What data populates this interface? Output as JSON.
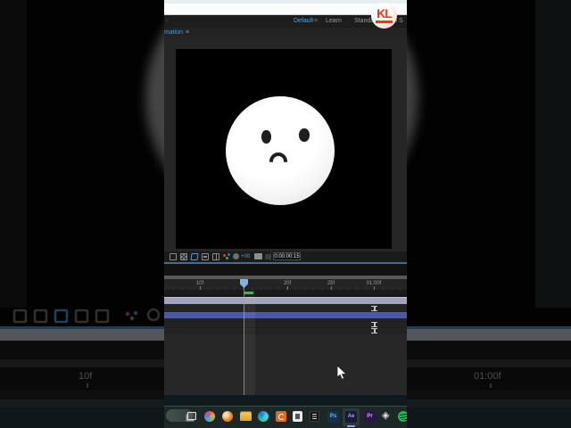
{
  "background": {
    "left_time_label": "10f",
    "right_time_label": "01:00f"
  },
  "watermark": {
    "text": "KL",
    "color": "#e8391d"
  },
  "menu_bar": {
    "left_glyph": "‹",
    "menu_icon": "≡",
    "workspaces": [
      {
        "label": "Default",
        "active": true
      },
      {
        "label": "Learn",
        "active": false
      },
      {
        "label": "Standard",
        "active": false
      },
      {
        "label": "ll S",
        "active": false
      }
    ]
  },
  "panel_tab": {
    "label": "mation",
    "menu_icon": "≡"
  },
  "viewer_toolbar": {
    "icons": [
      "preview-toggle-icon",
      "transparency-grid-icon",
      "mask-visibility-icon",
      "region-of-interest-icon",
      "view-options-icon",
      "channels-icon",
      "resolution-icon",
      "snapshot-camera-icon",
      "show-snapshot-icon"
    ],
    "exposure_label": "+00",
    "timecode": "0:00:00:15"
  },
  "timeline": {
    "ruler_labels": [
      {
        "text": "10f"
      },
      {
        "text": "20f"
      },
      {
        "text": "25f"
      },
      {
        "text": "01:00f"
      }
    ],
    "playhead_frame": "15f",
    "layers": [
      {
        "name": "lavender-layer",
        "color": "#a2a2bd"
      },
      {
        "name": "dark-layer-1",
        "out_handle": true
      },
      {
        "name": "selected-layer",
        "color": "#4c5aa6"
      },
      {
        "name": "dark-layer-2",
        "out_handle": true
      },
      {
        "name": "dark-layer-3",
        "out_handle": true
      }
    ]
  },
  "taskbar": {
    "apps": [
      {
        "name": "search-pill",
        "label": ""
      },
      {
        "name": "task-view",
        "label": ""
      },
      {
        "name": "photos",
        "label": ""
      },
      {
        "name": "blender",
        "label": ""
      },
      {
        "name": "file-explorer",
        "label": ""
      },
      {
        "name": "edge",
        "label": ""
      },
      {
        "name": "orange-spiral-app",
        "label": ""
      },
      {
        "name": "light-app",
        "label": ""
      },
      {
        "name": "dark-app",
        "label": ""
      },
      {
        "name": "photoshop",
        "label": "Ps"
      },
      {
        "name": "after-effects",
        "label": "Ae",
        "active": true
      },
      {
        "name": "premiere",
        "label": "Pr"
      },
      {
        "name": "cube-app",
        "label": ""
      },
      {
        "name": "spotify",
        "label": ""
      }
    ]
  },
  "colors": {
    "accent_blue": "#57a3e0",
    "panel_border_blue": "#3a6da0",
    "playhead_blue": "#7fb5e0",
    "work_area_green": "#3fae4a",
    "selected_layer_blue": "#4c5aa6",
    "lavender_layer": "#a2a2bd",
    "watermark_red": "#e8391d",
    "spotify_green": "#1db954"
  }
}
